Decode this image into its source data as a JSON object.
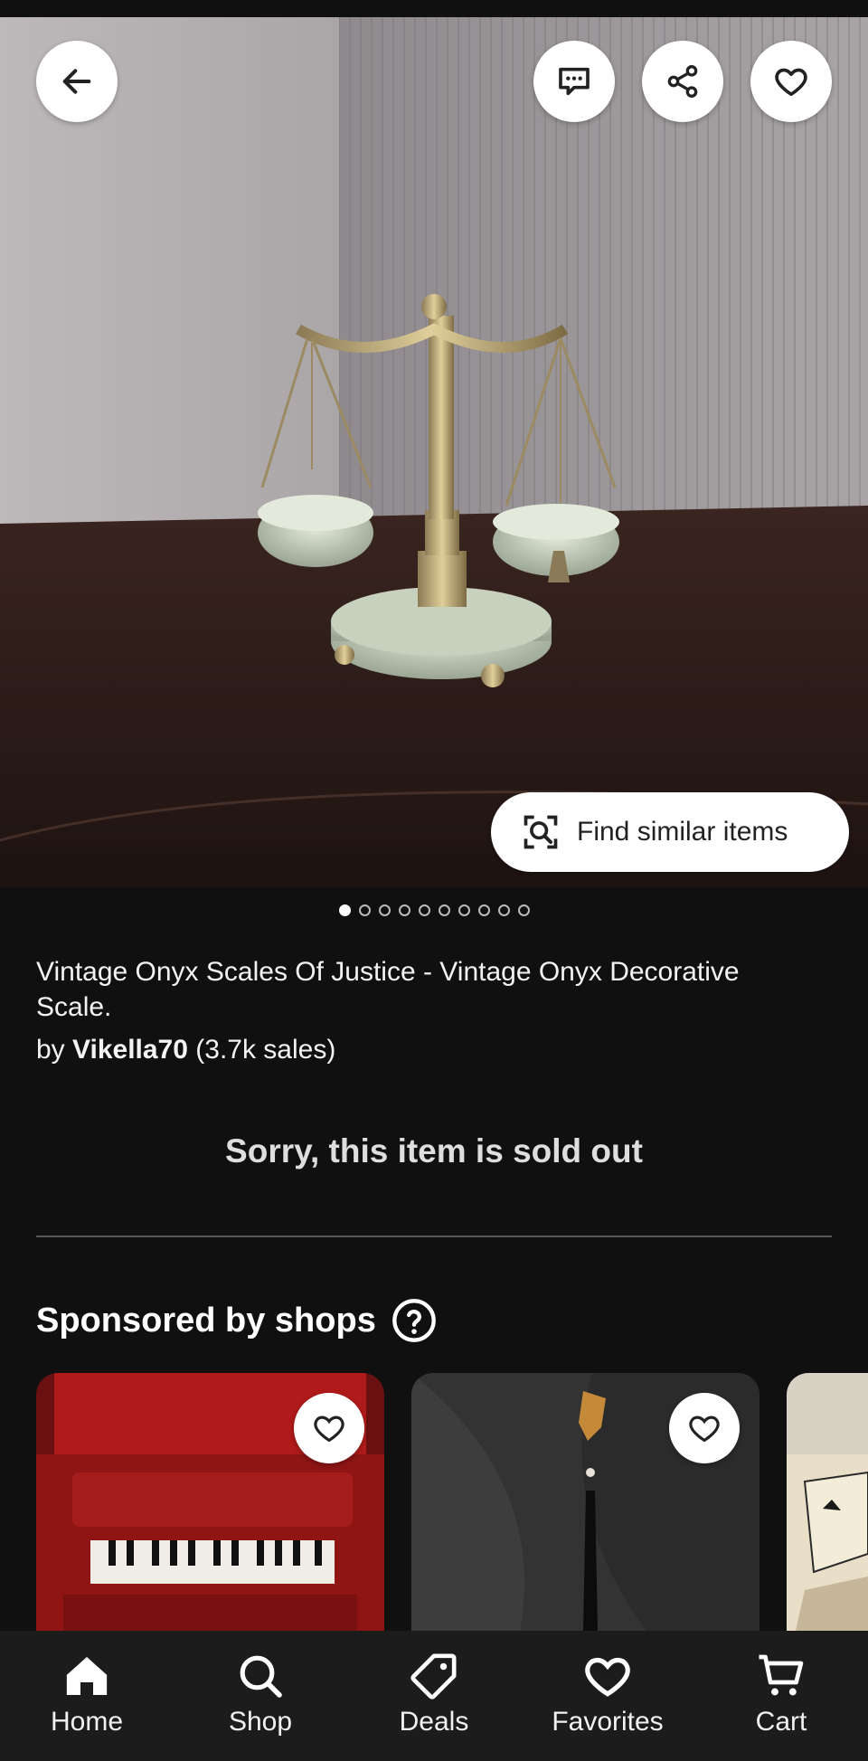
{
  "hero": {
    "find_similar_label": "Find similar items",
    "image_count": 10,
    "active_image_index": 0
  },
  "listing": {
    "title": "Vintage Onyx Scales Of Justice - Vintage Onyx Decorative Scale.",
    "by_prefix": "by",
    "seller_name": "Vikella70",
    "sales_text": "(3.7k sales)",
    "sold_out_message": "Sorry, this item is sold out"
  },
  "sponsored": {
    "heading": "Sponsored by shops"
  },
  "nav": {
    "items": [
      {
        "label": "Home",
        "icon": "home-icon",
        "active": true
      },
      {
        "label": "Shop",
        "icon": "search-icon"
      },
      {
        "label": "Deals",
        "icon": "tag-icon"
      },
      {
        "label": "Favorites",
        "icon": "heart-icon"
      },
      {
        "label": "Cart",
        "icon": "cart-icon"
      }
    ]
  },
  "colors": {
    "background": "#101010",
    "nav_background": "#1c1c1c",
    "button_background": "#ffffff"
  }
}
